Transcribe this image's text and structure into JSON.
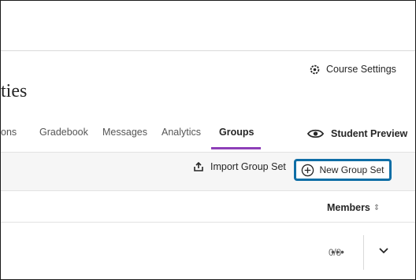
{
  "header": {
    "course_settings_label": "Course Settings",
    "page_title": "ties"
  },
  "tabs": [
    {
      "label": "ons",
      "active": false
    },
    {
      "label": "Gradebook",
      "active": false
    },
    {
      "label": "Messages",
      "active": false
    },
    {
      "label": "Analytics",
      "active": false
    },
    {
      "label": "Groups",
      "active": true
    }
  ],
  "student_preview_label": "Student Preview",
  "toolbar": {
    "import_label": "Import Group Set",
    "new_group_set_label": "New Group Set"
  },
  "table": {
    "members_header": "Members",
    "sort_glyph": "⇕",
    "rows": [
      {
        "members": "0/8",
        "more_glyph": "•••"
      }
    ]
  },
  "colors": {
    "accent_purple": "#8e3fb8",
    "highlight_blue": "#0f6ea6"
  },
  "icons": [
    "gear-icon",
    "eye-icon",
    "upload-icon",
    "plus-circle-icon",
    "chevron-down-icon"
  ]
}
